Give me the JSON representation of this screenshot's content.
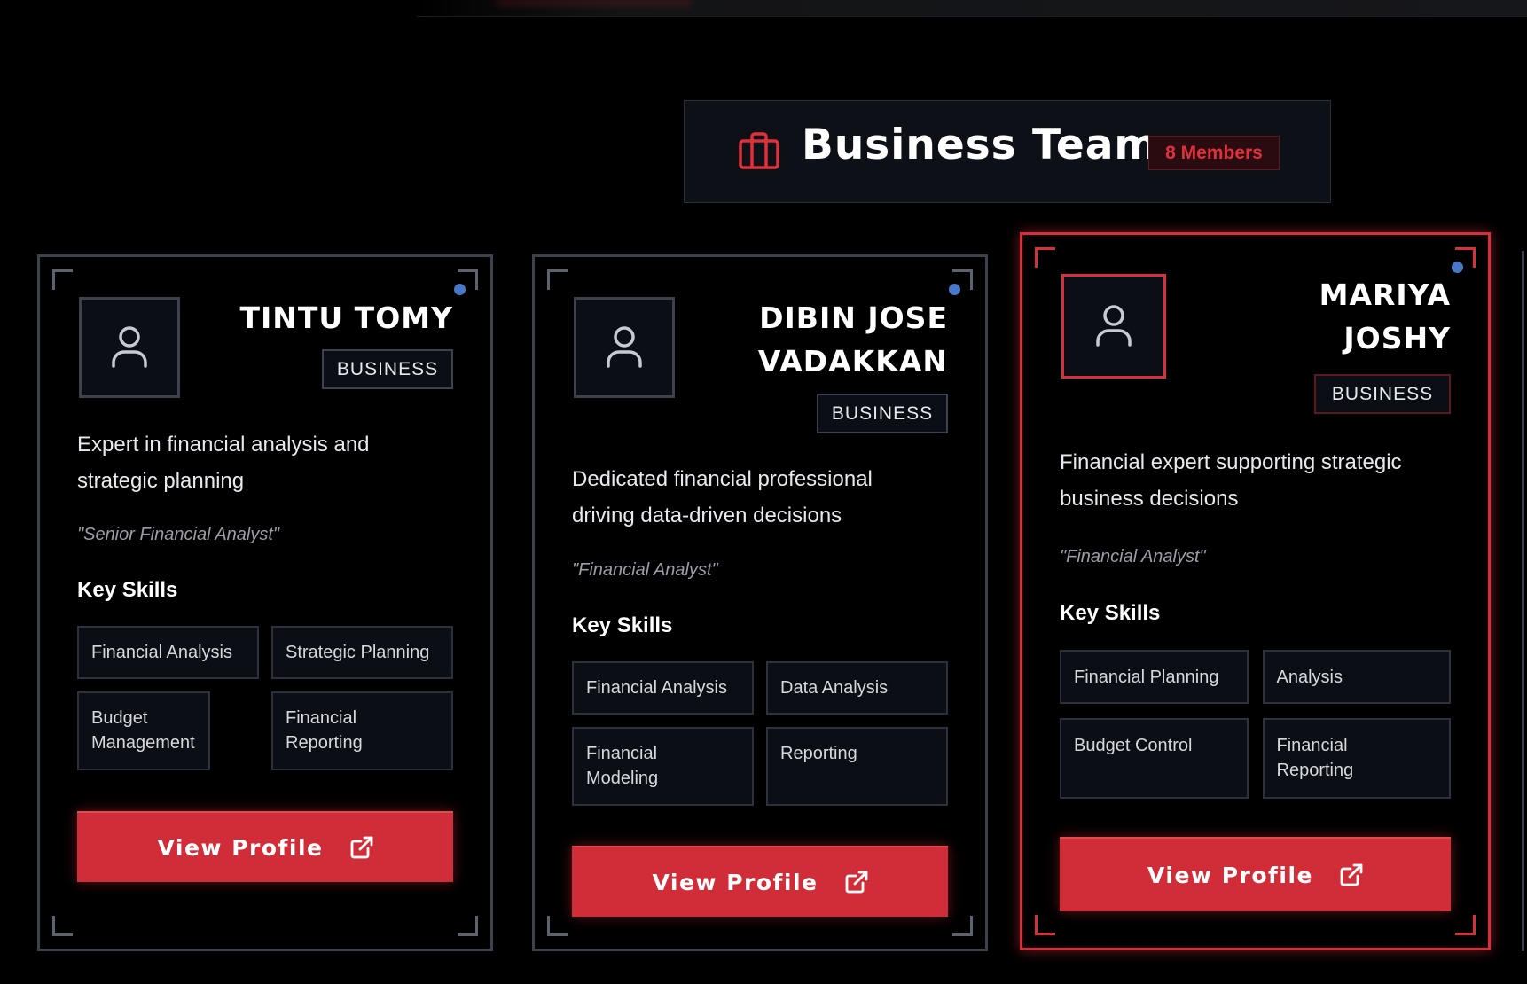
{
  "header": {
    "title": "Business Team",
    "members_badge": "8 Members",
    "icon": "briefcase-icon"
  },
  "cards": [
    {
      "name_lines": [
        "TINTU TOMY"
      ],
      "role": "BUSINESS",
      "description": "Expert in financial analysis and strategic planning",
      "title_quote": "\"Senior Financial Analyst\"",
      "skills_heading": "Key Skills",
      "skills": [
        "Financial Analysis",
        "Strategic Planning",
        "Budget Management",
        "Financial Reporting"
      ],
      "button_label": "View Profile",
      "active": false
    },
    {
      "name_lines": [
        "DIBIN JOSE",
        "VADAKKAN"
      ],
      "role": "BUSINESS",
      "description": "Dedicated financial professional driving data-driven decisions",
      "title_quote": "\"Financial Analyst\"",
      "skills_heading": "Key Skills",
      "skills": [
        "Financial Analysis",
        "Data Analysis",
        "Financial Modeling",
        "Reporting"
      ],
      "button_label": "View Profile",
      "active": false
    },
    {
      "name_lines": [
        "MARIYA",
        "JOSHY"
      ],
      "role": "BUSINESS",
      "description": "Financial expert supporting strategic business decisions",
      "title_quote": "\"Financial Analyst\"",
      "skills_heading": "Key Skills",
      "skills": [
        "Financial Planning",
        "Analysis",
        "Budget Control",
        "Financial Reporting"
      ],
      "button_label": "View Profile",
      "active": true
    }
  ],
  "colors": {
    "accent": "#d12d38",
    "status_dot": "#4a78c8",
    "card_border": "#3c424e",
    "background": "#000000"
  }
}
